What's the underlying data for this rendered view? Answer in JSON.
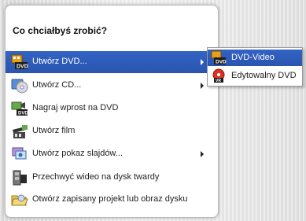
{
  "panel": {
    "title": "Co chciałbyś zrobić?"
  },
  "menu": {
    "items": [
      {
        "label": "Utwórz DVD...",
        "icon": "dvd-film-icon",
        "has_submenu": true,
        "selected": true
      },
      {
        "label": "Utwórz CD...",
        "icon": "cd-disc-icon",
        "has_submenu": true,
        "selected": false
      },
      {
        "label": "Nagraj wprost na DVD",
        "icon": "camera-to-dvd-icon",
        "has_submenu": false,
        "selected": false
      },
      {
        "label": "Utwórz film",
        "icon": "film-clapper-icon",
        "has_submenu": false,
        "selected": false
      },
      {
        "label": "Utwórz pokaz slajdów...",
        "icon": "slideshow-icon",
        "has_submenu": true,
        "selected": false
      },
      {
        "label": "Przechwyć wideo na dysk twardy",
        "icon": "video-capture-icon",
        "has_submenu": false,
        "selected": false
      },
      {
        "label": "Otwórz zapisany projekt lub obraz dysku",
        "icon": "open-folder-icon",
        "has_submenu": false,
        "selected": false
      }
    ]
  },
  "submenu": {
    "items": [
      {
        "label": "DVD-Video",
        "icon": "dvd-video-icon",
        "selected": true
      },
      {
        "label": "Edytowalny DVD",
        "icon": "editable-dvd-icon",
        "selected": false
      }
    ]
  },
  "colors": {
    "highlight": "#2f5dbd",
    "highlight_text": "#ffffff",
    "text": "#222222"
  }
}
